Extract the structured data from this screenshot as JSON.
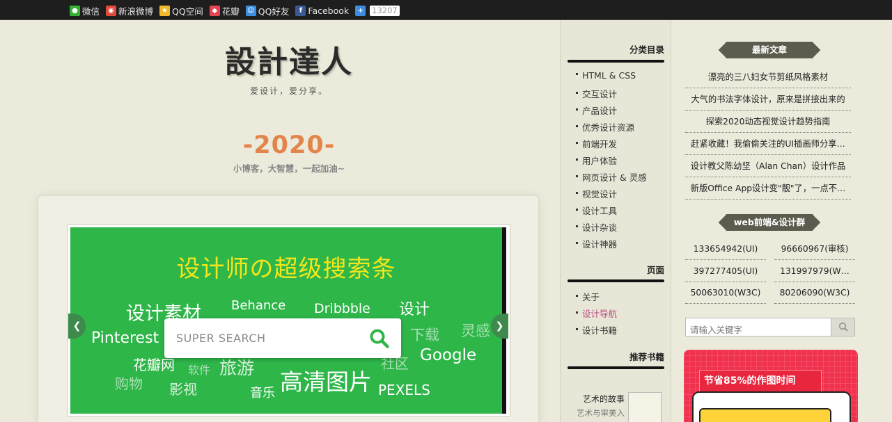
{
  "share": {
    "items": [
      {
        "label": "微信",
        "icon": "wechat-icon",
        "color": "#35b035"
      },
      {
        "label": "新浪微博",
        "icon": "weibo-icon",
        "color": "#e24a3d"
      },
      {
        "label": "QQ空间",
        "icon": "qzone-icon",
        "color": "#f1b92b"
      },
      {
        "label": "花瓣",
        "icon": "huaban-icon",
        "color": "#e54553"
      },
      {
        "label": "QQ好友",
        "icon": "qq-icon",
        "color": "#3d8ee0"
      },
      {
        "label": "Facebook",
        "icon": "facebook-icon",
        "color": "#3b5998"
      }
    ],
    "more_icon": "plus-icon",
    "count": "13207"
  },
  "site": {
    "title": "設計達人",
    "subtitle": "爱设计，爱分享。"
  },
  "year": {
    "label": "-2020-",
    "motto": "小博客，大智慧，一起加油~"
  },
  "banner": {
    "title": "设计师の超级搜索条",
    "search_placeholder": "SUPER SEARCH",
    "words": [
      "设计素材",
      "Behance",
      "Dribbble",
      "设计",
      "Pinterest",
      "下载",
      "灵感",
      "花瓣网",
      "软件",
      "旅游",
      "社区",
      "Google",
      "购物",
      "影视",
      "音乐",
      "高清图片",
      "PEXELS"
    ]
  },
  "sidebar": {
    "categories_heading": "分类目录",
    "categories": [
      "HTML & CSS",
      "交互设计",
      "产品设计",
      "优秀设计资源",
      "前端开发",
      "用户体验",
      "网页设计 & 灵感",
      "视觉设计",
      "设计工具",
      "设计杂谈",
      "设计神器"
    ],
    "pages_heading": "页面",
    "pages": [
      "关于",
      "设计导航",
      "设计书籍"
    ],
    "books_heading": "推荐书籍",
    "book_title": "艺术的故事",
    "book_sub": "艺术与审美入"
  },
  "latest": {
    "heading": "最新文章",
    "articles": [
      "漂亮的三八妇女节剪纸风格素材",
      "大气的书法字体设计，原来是拼接出来的",
      "探索2020动态视觉设计趋势指南",
      "赶紧收藏！我偷偷关注的UI插画师分享…",
      "设计教父陈幼坚（Alan Chan）设计作品",
      "新版Office App设计变\"靓\"了，一点不…"
    ]
  },
  "groups": {
    "heading": "web前端&设计群",
    "items": [
      "133654942(UI)",
      "96660967(审核)",
      "397277405(UI)",
      "131997979(W…",
      "50063010(W3C)",
      "80206090(W3C)"
    ]
  },
  "search": {
    "placeholder": "请输入关键字"
  },
  "ad": {
    "tag": "节省85%的作图时间"
  },
  "colors": {
    "accent_orange": "#e3854a",
    "banner_green": "#2eb649",
    "banner_title": "#f3e61c",
    "ribbon": "#5c5c4e",
    "ad_red": "#f0324e"
  }
}
